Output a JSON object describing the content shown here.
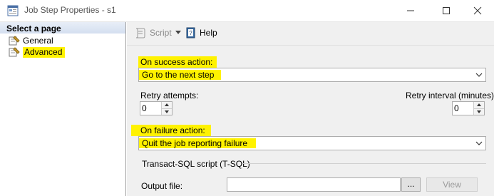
{
  "window": {
    "title": "Job Step Properties - s1",
    "minimize_icon": "minimize-icon",
    "maximize_icon": "maximize-icon",
    "close_icon": "close-icon"
  },
  "sidebar": {
    "header": "Select a page",
    "items": [
      {
        "label": "General",
        "icon": "page-wrench-icon"
      },
      {
        "label": "Advanced",
        "icon": "page-wrench-icon",
        "selected": true
      }
    ]
  },
  "toolbar": {
    "script_label": "Script",
    "help_label": "Help"
  },
  "form": {
    "on_success_label": "On success action:",
    "on_success_value": "Go to the next step",
    "retry_attempts_label": "Retry attempts:",
    "retry_attempts_value": "0",
    "retry_interval_label": "Retry interval (minutes):",
    "retry_interval_value": "0",
    "on_failure_label": "On failure action:",
    "on_failure_value": "Quit the job reporting failure",
    "tsql_section_label": "Transact-SQL script (T-SQL)",
    "output_file_label": "Output file:",
    "output_file_value": "",
    "browse_label": "...",
    "view_label": "View"
  },
  "colors": {
    "highlight": "#fff200",
    "pane_background": "#f0f0f0"
  }
}
